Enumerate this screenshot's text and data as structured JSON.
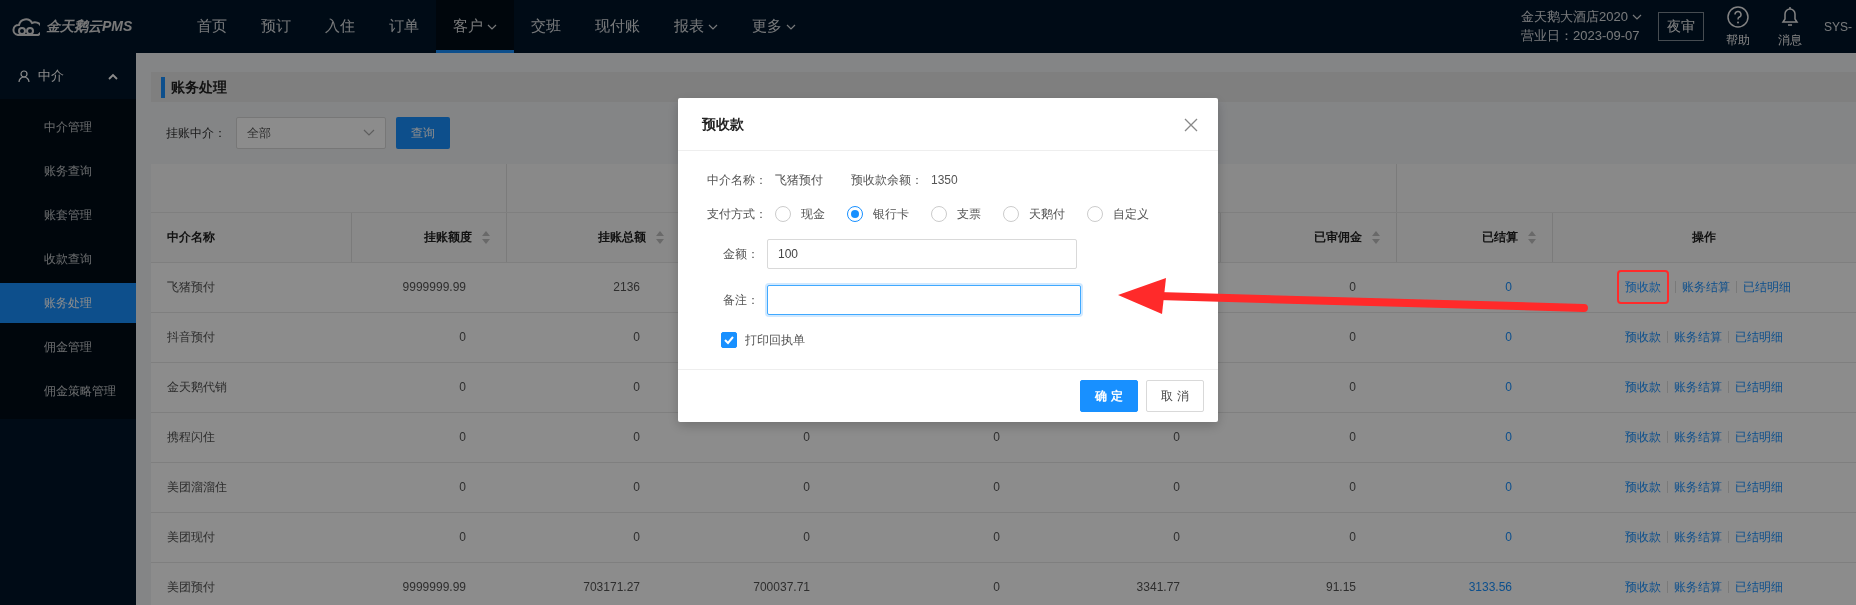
{
  "top_bar": {
    "logo": "金天鹅云PMS",
    "nav": [
      {
        "label": "首页",
        "selected": false,
        "dropdown": false
      },
      {
        "label": "预订",
        "selected": false,
        "dropdown": false
      },
      {
        "label": "入住",
        "selected": false,
        "dropdown": false
      },
      {
        "label": "订单",
        "selected": false,
        "dropdown": false
      },
      {
        "label": "客户",
        "selected": true,
        "dropdown": true
      },
      {
        "label": "交班",
        "selected": false,
        "dropdown": false
      },
      {
        "label": "现付账",
        "selected": false,
        "dropdown": false
      },
      {
        "label": "报表",
        "selected": false,
        "dropdown": true
      },
      {
        "label": "更多",
        "selected": false,
        "dropdown": true
      }
    ],
    "hotel": "金天鹅大酒店2020",
    "business_date": "营业日：2023-09-07",
    "night_audit": "夜审",
    "help": "帮助",
    "messages": "消息",
    "user": "SYS-"
  },
  "sidebar": {
    "group": "中介",
    "expanded": true,
    "items": [
      {
        "label": "中介管理",
        "selected": false
      },
      {
        "label": "账务查询",
        "selected": false
      },
      {
        "label": "账套管理",
        "selected": false
      },
      {
        "label": "收款查询",
        "selected": false
      },
      {
        "label": "账务处理",
        "selected": true
      },
      {
        "label": "佣金管理",
        "selected": false
      },
      {
        "label": "佣金策略管理",
        "selected": false
      }
    ]
  },
  "page_title": "账务处理",
  "filter": {
    "label": "挂账中介：",
    "value": "全部",
    "button": "查询"
  },
  "table": {
    "columns": [
      {
        "label": "中介名称",
        "sortable": false,
        "kind": "name"
      },
      {
        "label": "挂账额度",
        "sortable": true,
        "kind": "number"
      },
      {
        "label": "挂账总额",
        "sortable": true,
        "kind": "number"
      },
      null,
      null,
      null,
      {
        "label": "已审佣金",
        "sortable": true,
        "kind": "number"
      },
      {
        "label": "已结算",
        "sortable": true,
        "kind": "link"
      },
      {
        "label": "操作",
        "sortable": false,
        "kind": "actions"
      }
    ],
    "rows": [
      {
        "cells": [
          "飞猪预付",
          "9999999.99",
          "2136",
          null,
          null,
          null,
          "0",
          "0"
        ],
        "actions": [
          "预收款",
          "账务结算",
          "已结明细"
        ],
        "annotated": true
      },
      {
        "cells": [
          "抖音预付",
          "0",
          "0",
          null,
          null,
          null,
          "0",
          "0"
        ],
        "actions": [
          "预收款",
          "账务结算",
          "已结明细"
        ],
        "annotated": false
      },
      {
        "cells": [
          "金天鹅代销",
          "0",
          "0",
          null,
          null,
          null,
          "0",
          "0"
        ],
        "actions": [
          "预收款",
          "账务结算",
          "已结明细"
        ],
        "annotated": false
      },
      {
        "cells": [
          "携程闪住",
          "0",
          "0",
          "0",
          "0",
          "0",
          "0",
          "0"
        ],
        "actions": [
          "预收款",
          "账务结算",
          "已结明细"
        ],
        "annotated": false
      },
      {
        "cells": [
          "美团溜溜住",
          "0",
          "0",
          "0",
          "0",
          "0",
          "0",
          "0"
        ],
        "actions": [
          "预收款",
          "账务结算",
          "已结明细"
        ],
        "annotated": false
      },
      {
        "cells": [
          "美团现付",
          "0",
          "0",
          "0",
          "0",
          "0",
          "0",
          "0"
        ],
        "actions": [
          "预收款",
          "账务结算",
          "已结明细"
        ],
        "annotated": false
      },
      {
        "cells": [
          "美团预付",
          "9999999.99",
          "703171.27",
          "700037.71",
          "0",
          "3341.77",
          "91.15",
          "3133.56"
        ],
        "actions": [
          "预收款",
          "账务结算",
          "已结明细"
        ],
        "annotated": false
      }
    ]
  },
  "dialog": {
    "title": "预收款",
    "agent_label": "中介名称：",
    "agent": "飞猪预付",
    "balance_label": "预收款余额：",
    "balance": "1350",
    "payment_label": "支付方式：",
    "payment_methods": [
      {
        "label": "现金",
        "selected": false
      },
      {
        "label": "银行卡",
        "selected": true
      },
      {
        "label": "支票",
        "selected": false
      },
      {
        "label": "天鹅付",
        "selected": false
      },
      {
        "label": "自定义",
        "selected": false
      }
    ],
    "amount_label": "金额：",
    "amount": "100",
    "remark_label": "备注：",
    "remark_focused": true,
    "print_receipt": {
      "label": "打印回执单",
      "checked": true
    },
    "buttons": [
      {
        "label": "确 定",
        "kind": "primary"
      },
      {
        "label": "取 消",
        "kind": "default"
      }
    ]
  }
}
